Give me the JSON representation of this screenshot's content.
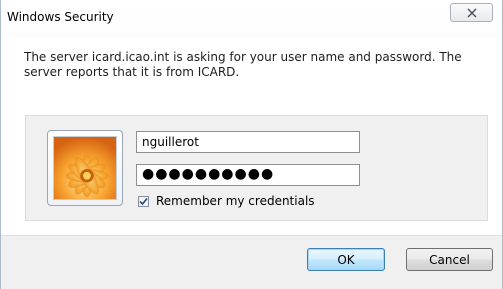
{
  "window": {
    "title": "Windows Security",
    "close_glyph": "☒"
  },
  "message": "The server icard.icao.int is asking for your user name and password. The server reports that it is from ICARD.",
  "credentials": {
    "username_value": "nguillerot",
    "password_mask": "●●●●●●●●●●",
    "remember_label": "Remember my credentials",
    "remember_checked": true,
    "avatar_icon": "user-tile-flower-icon"
  },
  "buttons": {
    "ok_label": "OK",
    "cancel_label": "Cancel"
  },
  "colors": {
    "accent_border": "#3c7fb1",
    "panel_bg": "#f0f0f0"
  }
}
